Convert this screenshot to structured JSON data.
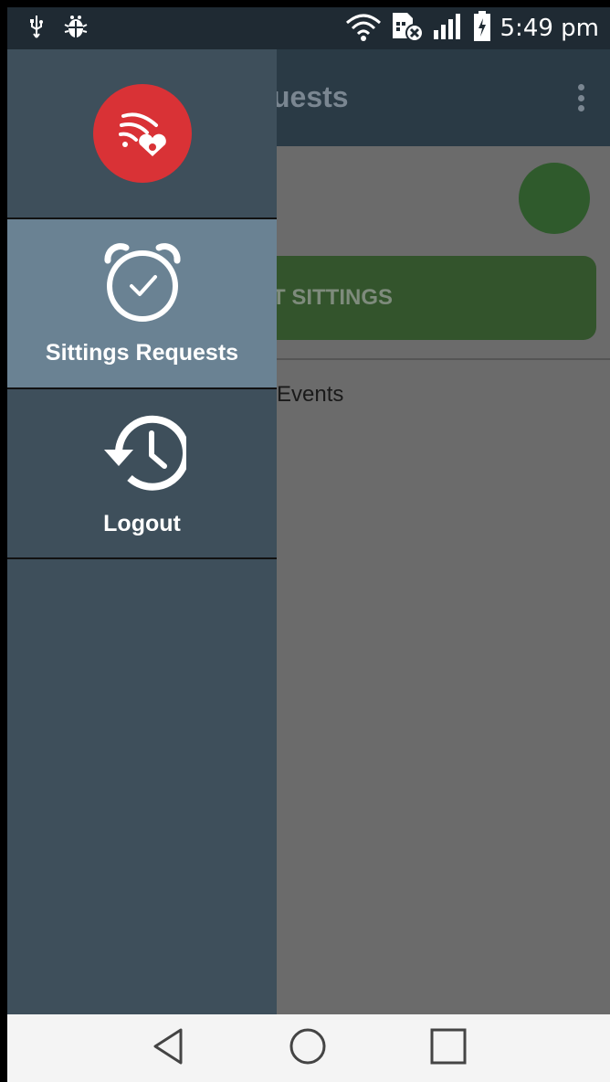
{
  "status_bar": {
    "time": "5:49 pm",
    "icons": [
      "usb-icon",
      "debug-icon",
      "wifi-icon",
      "sim-error-icon",
      "signal-icon",
      "battery-charging-icon"
    ]
  },
  "app": {
    "toolbar_title_visible": "uests",
    "button_label_visible": "T SITTINGS",
    "section_label_visible": "Events"
  },
  "drawer": {
    "items": [
      {
        "label": "Sittings Requests",
        "icon": "alarm-check-icon",
        "active": true
      },
      {
        "label": "Logout",
        "icon": "history-icon",
        "active": false
      }
    ]
  },
  "nav": {
    "icons": [
      "back-icon",
      "home-icon",
      "recent-apps-icon"
    ]
  },
  "colors": {
    "status_bar": "#1f2a33",
    "drawer_bg": "#3e4f5b",
    "drawer_active": "#6a8293",
    "logo_red": "#d93236",
    "scrim": "#6b6b6b"
  }
}
